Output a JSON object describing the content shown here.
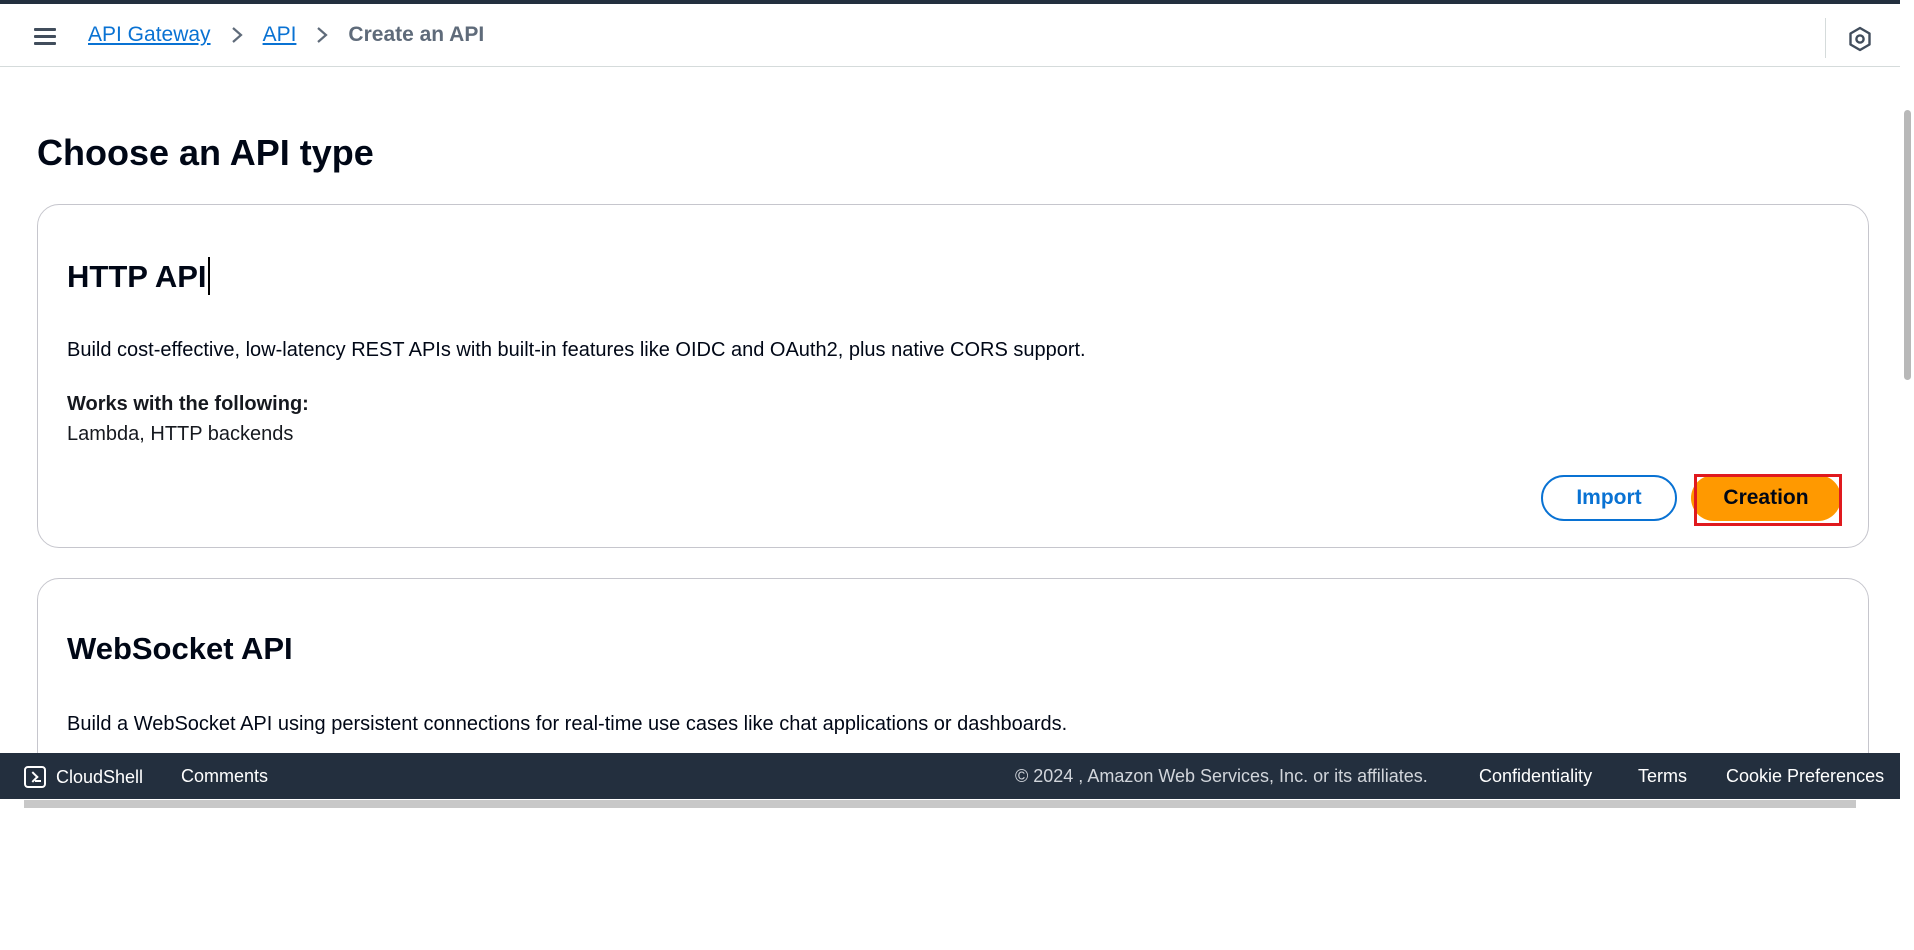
{
  "breadcrumb": {
    "items": [
      "API Gateway",
      "API"
    ],
    "current": "Create an API"
  },
  "page": {
    "title": "Choose an API type"
  },
  "http_card": {
    "title": "HTTP API",
    "description": "Build cost-effective, low-latency REST APIs with built-in features like OIDC and OAuth2, plus native CORS support.",
    "works_label": "Works with the following:",
    "works_value": "Lambda, HTTP backends",
    "import_label": "Import",
    "create_label": "Creation"
  },
  "ws_card": {
    "title": "WebSocket API",
    "description": "Build a WebSocket API using persistent connections for real-time use cases like chat applications or dashboards."
  },
  "footer": {
    "cloudshell": "CloudShell",
    "comments": "Comments",
    "copyright": "© 2024 , Amazon Web Services, Inc. or its affiliates.",
    "links": [
      "Confidentiality",
      "Terms",
      "Cookie Preferences"
    ]
  },
  "colors": {
    "link": "#0972d3",
    "primary_button": "#ff9900",
    "footer_bg": "#232f3e",
    "highlight": "#e0191e"
  },
  "icons": [
    "hamburger-menu-icon",
    "chevron-right-icon",
    "settings-icon",
    "cloudshell-icon"
  ]
}
